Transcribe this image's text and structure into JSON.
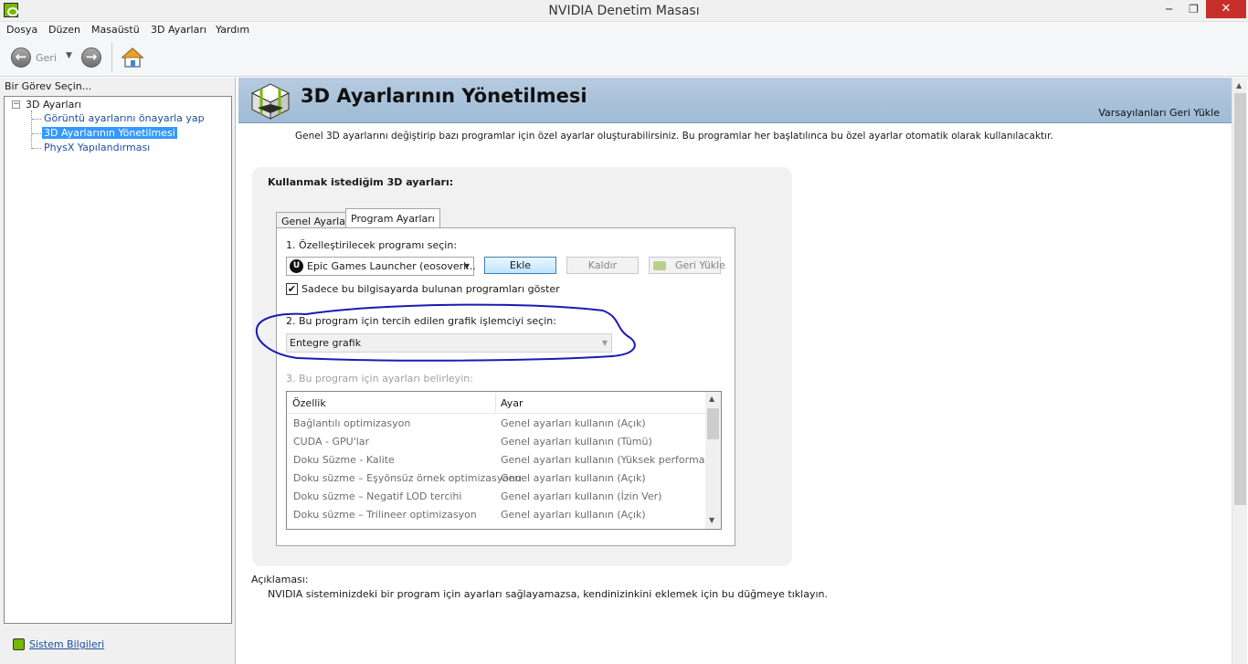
{
  "window": {
    "title": "NVIDIA Denetim Masası",
    "minimize": "─",
    "maximize": "❐",
    "close": "✕"
  },
  "menu": [
    "Dosya",
    "Düzen",
    "Masaüstü",
    "3D Ayarları",
    "Yardım"
  ],
  "toolbar": {
    "back_label": "Geri",
    "back_glyph": "←",
    "forward_glyph": "→",
    "dropdown_glyph": "▼"
  },
  "sidebar": {
    "title": "Bir Görev Seçin...",
    "toggle": "−",
    "root": "3D Ayarları",
    "items": [
      {
        "label": "Görüntü ayarlarını önayarla yap",
        "selected": false
      },
      {
        "label": "3D Ayarlarının Yönetilmesi",
        "selected": true
      },
      {
        "label": "PhysX Yapılandırması",
        "selected": false
      }
    ],
    "system_info": "Sistem Bilgileri"
  },
  "main": {
    "banner_title": "3D Ayarlarının Yönetilmesi",
    "restore_defaults": "Varsayılanları Geri Yükle",
    "description": "Genel 3D ayarlarını değiştirip bazı programlar için özel ayarlar oluşturabilirsiniz. Bu programlar her başlatılınca bu özel ayarlar otomatik olarak kullanılacaktır.",
    "card_title": "Kullanmak istediğim 3D ayarları:",
    "tabs": [
      {
        "label": "Genel Ayarlar",
        "active": false
      },
      {
        "label": "Program Ayarları",
        "active": true
      }
    ],
    "step1": "1. Özelleştirilecek programı seçin:",
    "program_select": {
      "value": "Epic Games Launcher (eosoverl...",
      "icon": "U"
    },
    "caret": "▼",
    "buttons": {
      "add": "Ekle",
      "remove": "Kaldır",
      "restore": "Geri Yükle"
    },
    "checkbox": {
      "label": "Sadece bu bilgisayarda bulunan programları göster",
      "checked": true,
      "mark": "✔"
    },
    "step2": "2. Bu program için tercih edilen grafik işlemciyi seçin:",
    "gpu_select": {
      "value": "Entegre grafik"
    },
    "step3": "3. Bu program için ayarları belirleyin:",
    "table": {
      "headers": [
        "Özellik",
        "Ayar"
      ],
      "rows": [
        [
          "Bağlantılı optimizasyon",
          "Genel ayarları kullanın (Açık)"
        ],
        [
          "CUDA - GPU'lar",
          "Genel ayarları kullanın (Tümü)"
        ],
        [
          "Doku Süzme - Kalite",
          "Genel ayarları kullanın (Yüksek performans)"
        ],
        [
          "Doku süzme – Eşyönsüz örnek optimizasyonu",
          "Genel ayarları kullanın (Açık)"
        ],
        [
          "Doku süzme – Negatif LOD tercihi",
          "Genel ayarları kullanın (İzin Ver)"
        ],
        [
          "Doku süzme – Trilineer optimizasyon",
          "Genel ayarları kullanın (Açık)"
        ]
      ],
      "scroll_up": "▲",
      "scroll_down": "▼"
    },
    "explanation_label": "Açıklaması:",
    "explanation_text": "NVIDIA sisteminizdeki bir program için ayarları sağlayamazsa, kendinizinkini eklemek için bu düğmeye tıklayın."
  },
  "colors": {
    "nvidia_green": "#76b900",
    "banner_blue": "#a9c3dc",
    "selection_blue": "#3399ff",
    "annotation_ink": "#1a1ab4"
  }
}
